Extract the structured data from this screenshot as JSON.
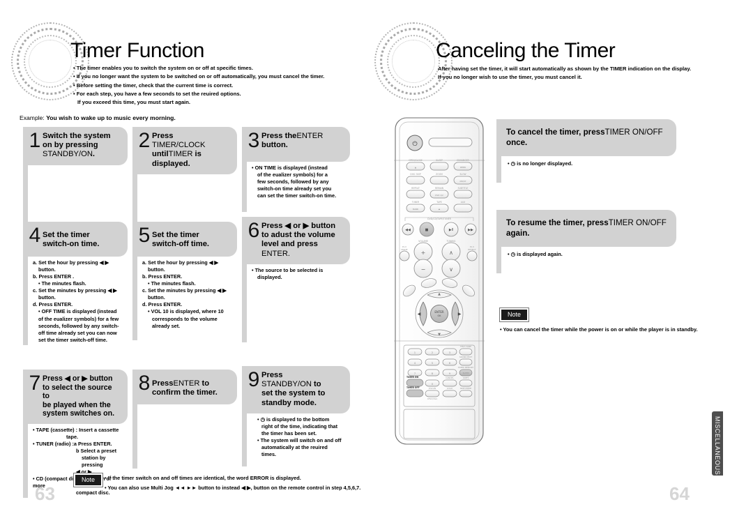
{
  "left_page": {
    "title": "Timer Function",
    "intro_bullets": [
      "The timer enables you to switch the system on or off at specific times.",
      "If you no longer want the system to be switched on or off automatically, you must cancel the timer.",
      "Before setting the timer, check that the current time is correct.",
      "For each step, you have a few seconds to set the reuired options."
    ],
    "intro_continuation": "If you exceed this time, you must start again.",
    "example_label": "Example:",
    "example_text": "You wish to wake up to music every morning.",
    "page_number": "63",
    "steps": [
      {
        "num": "1",
        "head_lines": [
          {
            "bold": "Switch the system"
          },
          {
            "bold": "on by pressing"
          },
          {
            "plain": "STANDBY/ON",
            "bold_tail": "."
          }
        ],
        "body": []
      },
      {
        "num": "2",
        "head_lines": [
          {
            "bold": "Press"
          },
          {
            "plain": "TIMER/CLOCK"
          },
          {
            "bold": "until",
            "plain2": "TIMER",
            "bold2": " is"
          },
          {
            "bold": "displayed."
          }
        ],
        "body": []
      },
      {
        "num": "3",
        "head_lines": [
          {
            "bold": "Press the",
            "plain2": "ENTER"
          },
          {
            "bold": "button."
          }
        ],
        "body": [
          "• ON TIME  is displayed (instead",
          "of the eualizer symbols) for a",
          "few seconds, followed by any",
          "switch-on time already set you",
          "can set the timer switch-on time."
        ]
      },
      {
        "num": "4",
        "head_lines": [
          {
            "bold": "Set the timer"
          },
          {
            "bold": "switch-on time."
          }
        ],
        "body": [
          "a. Set the hour by pressing ◀  ▶",
          "button.",
          "b. Press ENTER .",
          "• The minutes flash.",
          "c. Set the minutes by pressing ◀  ▶",
          "button.",
          "d. Press ENTER.",
          "• OFF TIME  is displayed (instead",
          "of the eualizer symbols) for a few",
          "seconds, followed by any switch-",
          "off time already set you can now",
          "set the timer switch-off time."
        ]
      },
      {
        "num": "5",
        "head_lines": [
          {
            "bold": "Set the timer"
          },
          {
            "bold": "switch-off time."
          }
        ],
        "body": [
          "a. Set the hour by pressing ◀  ▶",
          "button.",
          "b. Press ENTER.",
          "• The minutes flash.",
          "c. Set the minutes by pressing ◀  ▶",
          "button.",
          "d. Press ENTER.",
          "• VOL 10 is displayed, where 10",
          "corresponds to the volume",
          "already set."
        ]
      },
      {
        "num": "6",
        "head_lines": [
          {
            "bold": "Press ◀ or ▶  button"
          },
          {
            "bold": "to adust the volume"
          },
          {
            "bold": "level and press"
          },
          {
            "plain": "ENTER."
          }
        ],
        "body": [
          "• The source to be selected is",
          "displayed."
        ]
      },
      {
        "num": "7",
        "head_lines": [
          {
            "bold": "Press ◀ or ▶  button"
          },
          {
            "bold": "to select the source to"
          },
          {
            "bold": "be played when the"
          },
          {
            "bold": "system switches on."
          }
        ],
        "body": [
          "• TAPE (cassette) : Insert a cassette",
          "tape.",
          "• TUNER (radio) :a  Press ENTER.",
          "b  Select a preset",
          "station by pressing",
          "◀ or ▶ .",
          "• CD (compact disc) : Load on or more",
          "compact disc."
        ]
      },
      {
        "num": "8",
        "head_lines": [
          {
            "bold": "Press",
            "plain2": "ENTER",
            "bold2": " to"
          },
          {
            "bold": "confirm the timer."
          }
        ],
        "body": []
      },
      {
        "num": "9",
        "head_lines": [
          {
            "bold": "Press"
          },
          {
            "plain": "STANDBY/ON",
            "bold2": " to"
          },
          {
            "bold": "set the system to"
          },
          {
            "bold": "standby mode."
          }
        ],
        "body": [
          "• ◷ is displayed to the bottom",
          "right of the time, indicating that",
          "the timer has been set.",
          "• The system will switch on and off",
          "automatically at the reuired",
          "times."
        ]
      }
    ],
    "note": {
      "badge": "Note",
      "lines": [
        "• If the timer switch on and off times are identical, the word ERROR is displayed.",
        "• You can also use Multi Jog ◄◄ ►►  button to instead ◀ ▶,     button on the remote control in step 4,5,6,7."
      ]
    }
  },
  "right_page": {
    "title": "Canceling the Timer",
    "intro_lines": [
      "After having set the timer, it will start automatically as shown by the TIMER indication on the display.",
      "If you no longer wish to use the timer, you must cancel it."
    ],
    "page_number": "64",
    "side_tab": "MISCELLANEOUS",
    "boxes": [
      {
        "head_parts": {
          "bold": "To cancel the timer, press",
          "plain": "TIMER ON/OFF",
          "bold2": "once."
        },
        "body": "• ◷  is no longer displayed."
      },
      {
        "head_parts": {
          "bold": "To resume the timer, press",
          "plain": "TIMER ON/OFF",
          "bold2": "again."
        },
        "body": "• ◷  is displayed again."
      }
    ],
    "note": {
      "badge": "Note",
      "line": "• You can cancel the timer while the power is on or while the player is in standby."
    }
  },
  "remote": {
    "name": "remote-control-illustration",
    "power_label": "⏻",
    "row_labels_top": [
      [
        "OPEN/CLOSE",
        "SLEEP",
        "ENHANCER"
      ],
      [
        "DISC SKIP",
        "ZOOM",
        "SLOW"
      ],
      [
        "REPEAT",
        "REMAIN",
        "SUBTITLE"
      ],
      [
        "TUNER",
        "TAPE",
        "AUX"
      ]
    ],
    "inner_btn_labels": [
      [
        "▲"
      ],
      [
        "",
        "",
        "DEMO"
      ],
      [
        "",
        "",
        "MO/ST"
      ],
      [
        "",
        "DVD 1/2",
        ""
      ],
      [
        "BAND",
        "⏏",
        ""
      ]
    ],
    "transport_label": "DVD/CD/TAPE/TUNER",
    "volume_label": "VOLUME",
    "tuning_label": "TUNING",
    "pl_mode_label": "MODE",
    "pl_effect_label": "EFFECT",
    "enter_label": "ENTER",
    "keys": [
      "1",
      "2",
      "3",
      "4",
      "5",
      "6",
      "7",
      "8",
      "9",
      "0"
    ],
    "side_keys": [
      "TEST TONE",
      "SOUND EDIT",
      "TIMER MEMORY",
      "SLEEP"
    ],
    "fn_keys": [
      "CANCEL",
      "SHIFT",
      "LOGO",
      "MODE"
    ],
    "timer_on_label": "TIMER ON",
    "timer_off_label": "TIMER OFF"
  },
  "colors": {
    "box_gray": "#d2d2d2",
    "note_black": "#1b1b1b",
    "tab_gray": "#4e4e4e",
    "pagenum_gray": "#d6d6d6"
  }
}
